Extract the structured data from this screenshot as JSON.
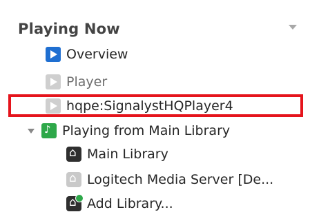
{
  "header": {
    "title": "Playing Now",
    "menu_icon": "chevron-down-icon"
  },
  "tree": {
    "items": [
      {
        "label": "Overview",
        "icon": "play-blue-icon"
      },
      {
        "label": "Player",
        "icon": "play-gray-icon"
      },
      {
        "label": "hqpe:SignalystHQPlayer4",
        "icon": "play-gray-icon"
      },
      {
        "label": "Playing from Main Library",
        "icon": "playing-from-icon",
        "expanded": true
      },
      {
        "label": "Main Library",
        "icon": "library-icon"
      },
      {
        "label": "Logitech Media Server [De...",
        "icon": "library-gray-icon"
      },
      {
        "label": "Add Library...",
        "icon": "add-library-icon"
      }
    ]
  },
  "colors": {
    "accent_blue": "#1f6fd1",
    "accent_green": "#2ea84a",
    "highlight_red": "#e5141c"
  }
}
